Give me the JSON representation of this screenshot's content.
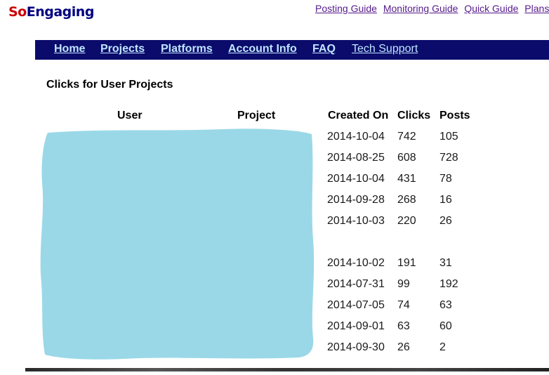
{
  "logo": {
    "part1": "So",
    "part2": "Engaging"
  },
  "top_links": [
    "Posting Guide",
    "Monitoring Guide",
    "Quick Guide",
    "Plans & Pr"
  ],
  "nav": {
    "home": "Home",
    "projects": "Projects",
    "platforms": "Platforms",
    "account": "Account Info",
    "faq": "FAQ",
    "tech": "Tech Support"
  },
  "page_title": "Clicks for User Projects",
  "table": {
    "headers": {
      "user": "User",
      "project": "Project",
      "created": "Created On",
      "clicks": "Clicks",
      "posts": "Posts"
    },
    "rows": [
      {
        "created": "2014-10-04",
        "clicks": "742",
        "posts": "105"
      },
      {
        "created": "2014-08-25",
        "clicks": "608",
        "posts": "728"
      },
      {
        "created": "2014-10-04",
        "clicks": "431",
        "posts": "78"
      },
      {
        "created": "2014-09-28",
        "clicks": "268",
        "posts": "16"
      },
      {
        "created": "2014-10-03",
        "clicks": "220",
        "posts": "26"
      },
      {
        "created": "2014-10-02",
        "clicks": "191",
        "posts": "31"
      },
      {
        "created": "2014-07-31",
        "clicks": "99",
        "posts": "192"
      },
      {
        "created": "2014-07-05",
        "clicks": "74",
        "posts": "63"
      },
      {
        "created": "2014-09-01",
        "clicks": "63",
        "posts": "60"
      },
      {
        "created": "2014-09-30",
        "clicks": "26",
        "posts": "2"
      }
    ]
  },
  "colors": {
    "nav_bg": "#0b0b6b",
    "redaction": "#9ad8e8",
    "logo_red": "#cc0000",
    "logo_navy": "#000080"
  }
}
